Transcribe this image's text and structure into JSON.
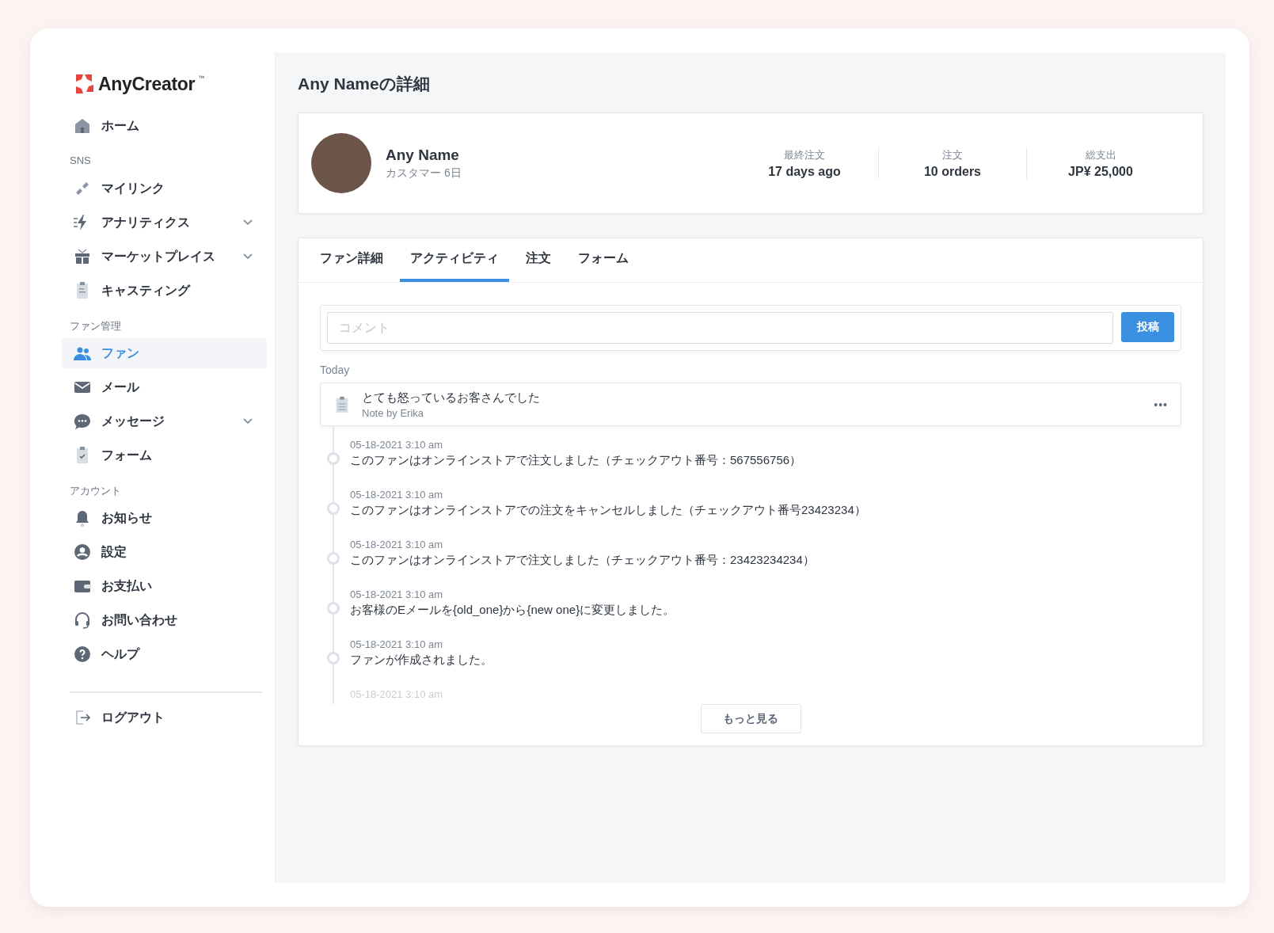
{
  "brand": {
    "name": "AnyCreator",
    "mark": "™"
  },
  "sidebar": {
    "sections": [
      {
        "items": [
          {
            "label": "ホーム",
            "selected": false
          }
        ]
      },
      {
        "label": "SNS",
        "items": [
          {
            "label": "マイリンク",
            "selected": false
          },
          {
            "label": "アナリティクス",
            "selected": false,
            "expanded": false
          },
          {
            "label": "マーケットプレイス",
            "selected": false,
            "expanded": false
          },
          {
            "label": "キャスティング",
            "selected": false
          }
        ]
      },
      {
        "label": "ファン管理",
        "items": [
          {
            "label": "ファン",
            "selected": true
          },
          {
            "label": "メール",
            "selected": false
          },
          {
            "label": "メッセージ",
            "selected": false,
            "expanded": false
          },
          {
            "label": "フォーム",
            "selected": false
          }
        ]
      },
      {
        "label": "アカウント",
        "items": [
          {
            "label": "お知らせ",
            "selected": false
          },
          {
            "label": "設定",
            "selected": false
          },
          {
            "label": "お支払い",
            "selected": false
          },
          {
            "label": "お問い合わせ",
            "selected": false
          },
          {
            "label": "ヘルプ",
            "selected": false
          }
        ]
      }
    ],
    "logout": "ログアウト"
  },
  "page_title": "Any Nameの詳細",
  "profile": {
    "name": "Any Name",
    "subtitle": "カスタマー 6日",
    "stats": [
      {
        "label": "最終注文",
        "value": "17 days ago"
      },
      {
        "label": "注文",
        "value": "10 orders"
      },
      {
        "label": "総支出",
        "value": "JP¥ 25,000"
      }
    ]
  },
  "tabs": [
    {
      "label": "ファン詳細",
      "selected": false
    },
    {
      "label": "アクティビティ",
      "selected": true
    },
    {
      "label": "注文",
      "selected": false
    },
    {
      "label": "フォーム",
      "selected": false
    }
  ],
  "comment": {
    "placeholder": "コメント",
    "button": "投稿"
  },
  "day_label": "Today",
  "note": {
    "text": "とても怒っているお客さんでした",
    "author": "Note by Erika",
    "menu": "•••"
  },
  "timeline": [
    {
      "time": "05-18-2021 3:10 am",
      "text": "このファンはオンラインストアで注文しました（チェックアウト番号：567556756）"
    },
    {
      "time": "05-18-2021 3:10 am",
      "text": "このファンはオンラインストアでの注文をキャンセルしました（チェックアウト番号23423234）"
    },
    {
      "time": "05-18-2021 3:10 am",
      "text": "このファンはオンラインストアで注文しました（チェックアウト番号：23423234234）"
    },
    {
      "time": "05-18-2021 3:10 am",
      "text": "お客様のEメールを{old_one}から{new one}に変更しました。"
    },
    {
      "time": "05-18-2021 3:10 am",
      "text": "ファンが作成されました。"
    },
    {
      "time": "05-18-2021 3:10 am"
    }
  ],
  "more_button": "もっと見る"
}
